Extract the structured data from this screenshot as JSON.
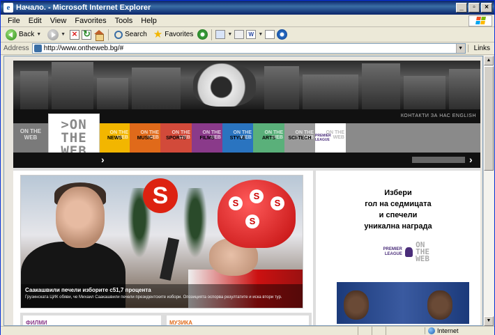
{
  "window": {
    "title": "Начало. - Microsoft Internet Explorer",
    "minimize": "_",
    "maximize": "▫",
    "close": "×"
  },
  "menu": [
    "File",
    "Edit",
    "View",
    "Favorites",
    "Tools",
    "Help"
  ],
  "toolbar": {
    "back": "Back",
    "search": "Search",
    "favorites": "Favorites"
  },
  "address": {
    "label": "Address",
    "url": "http://www.ontheweb.bg/#",
    "links": "Links"
  },
  "status": {
    "zone": "Internet"
  },
  "site": {
    "contact_links": "КОНТАКТИ   ЗА НАС   ENGLISH",
    "small_logo": "ON THE WEB",
    "logo_lines": [
      ">ON",
      "THE",
      "WEB"
    ],
    "categories": [
      {
        "label": "NEWS",
        "color": "#f2b600"
      },
      {
        "label": "MUSIC",
        "color": "#e06a1a"
      },
      {
        "label": "SPORTS",
        "color": "#d24a3a"
      },
      {
        "label": "FILMS",
        "color": "#8a3a8a"
      },
      {
        "label": "STYLE",
        "color": "#2a74c0"
      },
      {
        "label": "ARTS",
        "color": "#5ab07a"
      },
      {
        "label": "SCI-TECH",
        "color": "#9a9a9a"
      },
      {
        "label": "PREMIER LEAGUE",
        "color": "#ffffff"
      }
    ],
    "category_overlay": "ON THE WEB",
    "feature": {
      "title": "Саакашвили печели изборите с51,7 процента",
      "text": "Грузинската ЦИК обяви, че Михаил Саакашвили печели президентските избори. Опозицията оспорва резултатите и иска втори тур."
    },
    "promo": {
      "lines": [
        "Избери",
        "гол на седмицата",
        "и спечели",
        "уникална награда"
      ],
      "pl_badge": "PREMIER LEAGUE",
      "pl_onweb": [
        "ON",
        "THE",
        "WEB"
      ]
    },
    "boxes": {
      "films": "ФИЛМИ",
      "music": "МУЗИКА"
    }
  }
}
